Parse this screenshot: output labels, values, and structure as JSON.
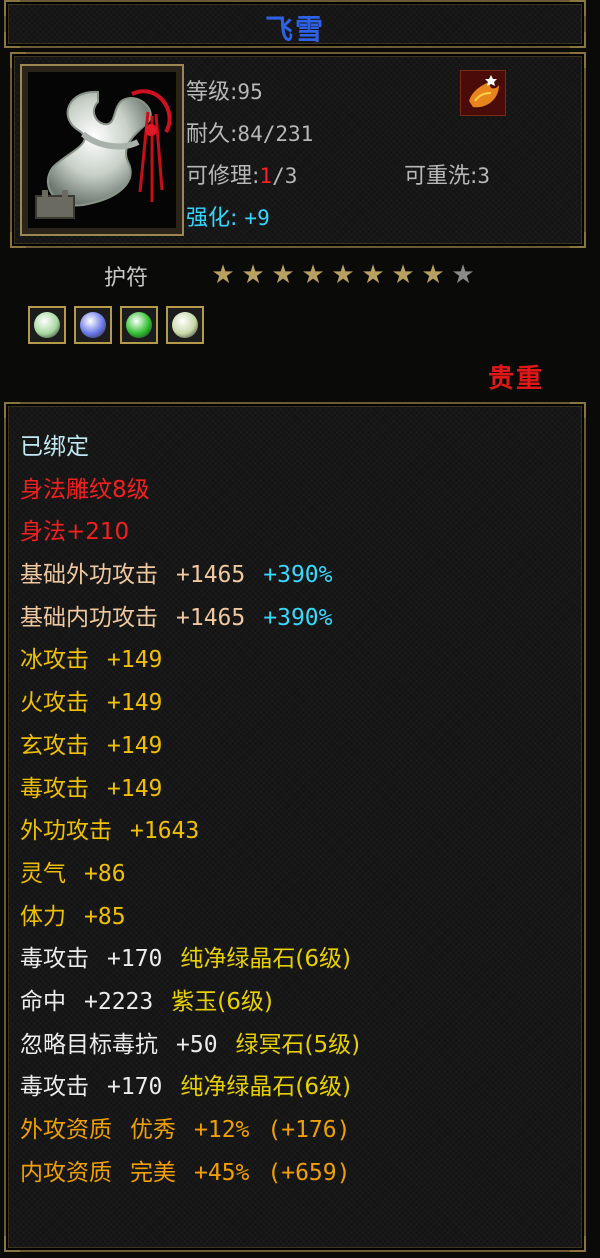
{
  "title": "飞雪",
  "stats": {
    "level_label": "等级:",
    "level_value": "95",
    "durability_label": "耐久:",
    "durability_value": "84/231",
    "repair_label": "可修理:",
    "repair_current": "1",
    "repair_max": "/3",
    "rewash_label": "可重洗:",
    "rewash_value": "3",
    "enhance_label": "强化:",
    "enhance_value": "+9"
  },
  "item_type": "护符",
  "stars": {
    "filled": 8,
    "total": 9
  },
  "gems": [
    {
      "icon": "pale-gem-icon",
      "color": "#a8d8a0"
    },
    {
      "icon": "blue-gem-icon",
      "color": "#6a78e8"
    },
    {
      "icon": "green-gem-icon",
      "color": "#30c030"
    },
    {
      "icon": "pale-gem-icon",
      "color": "#c8d8a8"
    }
  ],
  "quality": "贵重",
  "attributes": [
    {
      "color": "bind",
      "segments": [
        "已绑定"
      ]
    },
    {
      "color": "red",
      "segments": [
        "身法雕纹8级"
      ]
    },
    {
      "color": "red",
      "segments": [
        "身法+210"
      ]
    },
    {
      "color": "base",
      "segments": [
        "基础外功攻击",
        "+1465"
      ],
      "extra": "+390%"
    },
    {
      "color": "base",
      "segments": [
        "基础内功攻击",
        "+1465"
      ],
      "extra": "+390%"
    },
    {
      "color": "yellow",
      "segments": [
        "冰攻击",
        "+149"
      ]
    },
    {
      "color": "yellow",
      "segments": [
        "火攻击",
        "+149"
      ]
    },
    {
      "color": "yellow",
      "segments": [
        "玄攻击",
        "+149"
      ]
    },
    {
      "color": "yellow",
      "segments": [
        "毒攻击",
        "+149"
      ]
    },
    {
      "color": "yellow",
      "segments": [
        "外功攻击",
        "+1643"
      ]
    },
    {
      "color": "yellow",
      "segments": [
        "灵气",
        "+86"
      ]
    },
    {
      "color": "yellow",
      "segments": [
        "体力",
        "+85"
      ]
    },
    {
      "color": "white",
      "segments": [
        "毒攻击",
        "+170"
      ],
      "gem": "纯净绿晶石(6级)"
    },
    {
      "color": "white",
      "segments": [
        "命中",
        "+2223"
      ],
      "gem": "紫玉(6级)"
    },
    {
      "color": "white",
      "segments": [
        "忽略目标毒抗",
        "+50"
      ],
      "gem": "绿冥石(5级)"
    },
    {
      "color": "white",
      "segments": [
        "毒攻击",
        "+170"
      ],
      "gem": "纯净绿晶石(6级)"
    },
    {
      "color": "orange",
      "segments": [
        "外攻资质",
        "优秀",
        "+12%",
        "(+176)"
      ]
    },
    {
      "color": "orange",
      "segments": [
        "内攻资质",
        "完美",
        "+45%",
        "(+659)"
      ]
    }
  ],
  "colors": {
    "title": "#2e62e6",
    "bind": "#bfe8f0",
    "red": "#f42020",
    "base": "#f0c8a0",
    "cyan": "#38d8ff",
    "yellow": "#f0c000",
    "white": "#ececec",
    "gold": "#e8d000",
    "orange": "#f0a000"
  }
}
